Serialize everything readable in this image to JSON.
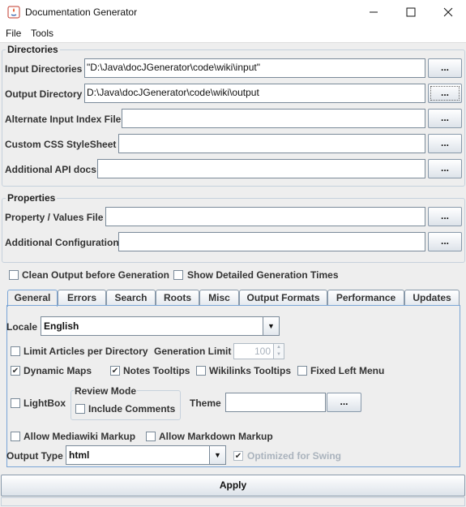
{
  "window": {
    "title": "Documentation Generator"
  },
  "menu": {
    "file": "File",
    "tools": "Tools"
  },
  "directories": {
    "legend": "Directories",
    "input_dirs": {
      "label": "Input Directories",
      "value": "\"D:\\Java\\docJGenerator\\code\\wiki\\input\""
    },
    "output_dir": {
      "label": "Output Directory",
      "value": "D:\\Java\\docJGenerator\\code\\wiki\\output"
    },
    "alt_index": {
      "label": "Alternate Input Index File",
      "value": ""
    },
    "custom_css": {
      "label": "Custom CSS StyleSheet",
      "value": ""
    },
    "api_docs": {
      "label": "Additional API docs",
      "value": ""
    },
    "browse": "..."
  },
  "properties": {
    "legend": "Properties",
    "prop_file": {
      "label": "Property / Values File",
      "value": ""
    },
    "add_config": {
      "label": "Additional Configuration",
      "value": ""
    }
  },
  "options": {
    "clean_output": "Clean Output before Generation",
    "show_times": "Show Detailed Generation Times"
  },
  "tabs": [
    "General",
    "Errors",
    "Search",
    "Roots",
    "Misc",
    "Output Formats",
    "Performance",
    "Updates"
  ],
  "general": {
    "locale_label": "Locale",
    "locale_value": "English",
    "limit_articles": "Limit Articles per Directory",
    "generation_limit": "Generation Limit",
    "generation_limit_value": "100",
    "dynamic_maps": "Dynamic Maps",
    "notes_tooltips": "Notes Tooltips",
    "wikilinks_tooltips": "Wikilinks Tooltips",
    "fixed_left_menu": "Fixed Left Menu",
    "lightbox": "LightBox",
    "review_mode": "Review Mode",
    "include_comments": "Include Comments",
    "theme_label": "Theme",
    "theme_value": "",
    "allow_mediawiki": "Allow Mediawiki Markup",
    "allow_markdown": "Allow Markdown Markup",
    "output_type_label": "Output Type",
    "output_type_value": "html",
    "optimized_swing": "Optimized for Swing"
  },
  "apply": "Apply"
}
